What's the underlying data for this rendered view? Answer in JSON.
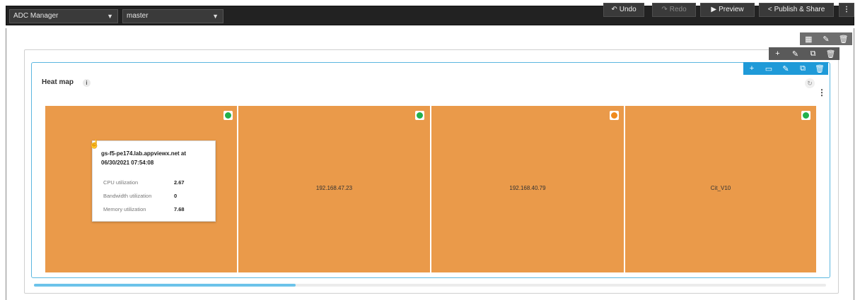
{
  "toolbar": {
    "app_select": "ADC Manager",
    "branch_select": "master",
    "undo_label": "Undo",
    "redo_label": "Redo",
    "preview_label": "Preview",
    "publish_label": "Publish & Share",
    "more_label": "⋮"
  },
  "widget": {
    "title": "Heat map",
    "info": "i"
  },
  "tiles": [
    {
      "label": "",
      "status_color": "#22b14c"
    },
    {
      "label": "192.168.47.23",
      "status_color": "#22b14c"
    },
    {
      "label": "192.168.40.79",
      "status_color": "#f08a1c"
    },
    {
      "label": "Cit_V10",
      "status_color": "#22b14c"
    }
  ],
  "tooltip": {
    "title": "gs-f5-pe174.lab.appviewx.net at 06/30/2021 07:54:08",
    "rows": [
      {
        "key": "CPU utilization",
        "value": "2.67"
      },
      {
        "key": "Bandwidth utilization",
        "value": "0"
      },
      {
        "key": "Memory utilization",
        "value": "7.68"
      }
    ]
  },
  "colors": {
    "tile": "#ea9a4a",
    "accent": "#1f9ad8",
    "toolbar": "#222222"
  }
}
